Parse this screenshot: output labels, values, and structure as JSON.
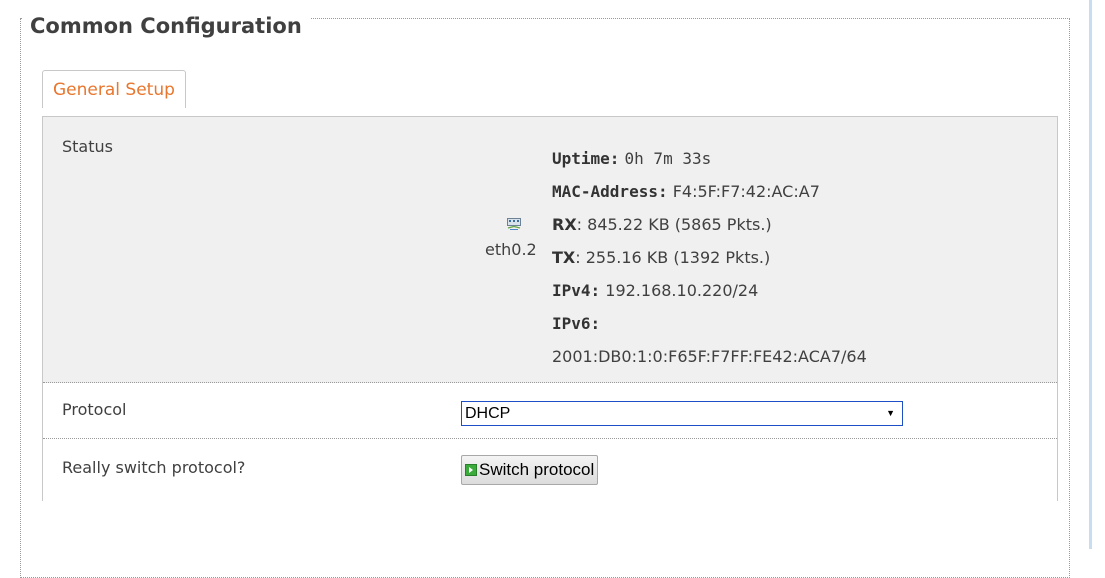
{
  "section": {
    "legend": "Common Configuration"
  },
  "tabs": [
    {
      "label": "General Setup",
      "active": true,
      "color": "#e8762d"
    }
  ],
  "status": {
    "label": "Status",
    "interface": {
      "icon": "ethernet-port-icon",
      "name": "eth0.2"
    },
    "fields": {
      "uptime_key": "Uptime:",
      "uptime_value": "0h 7m 33s",
      "mac_key": "MAC-Address:",
      "mac_value": "F4:5F:F7:42:AC:A7",
      "rx_key": "RX",
      "rx_value": ": 845.22 KB (5865 Pkts.)",
      "tx_key": "TX",
      "tx_value": ": 255.16 KB (1392 Pkts.)",
      "ipv4_key": "IPv4:",
      "ipv4_value": "192.168.10.220/24",
      "ipv6_key": "IPv6:",
      "ipv6_value": "2001:DB0:1:0:F65F:F7FF:FE42:ACA7/64"
    }
  },
  "protocol": {
    "label": "Protocol",
    "selected": "DHCP",
    "select_border_color": "#1f4fc6"
  },
  "switch": {
    "label": "Really switch protocol?",
    "button_label": "Switch protocol",
    "button_icon": "apply-icon"
  }
}
